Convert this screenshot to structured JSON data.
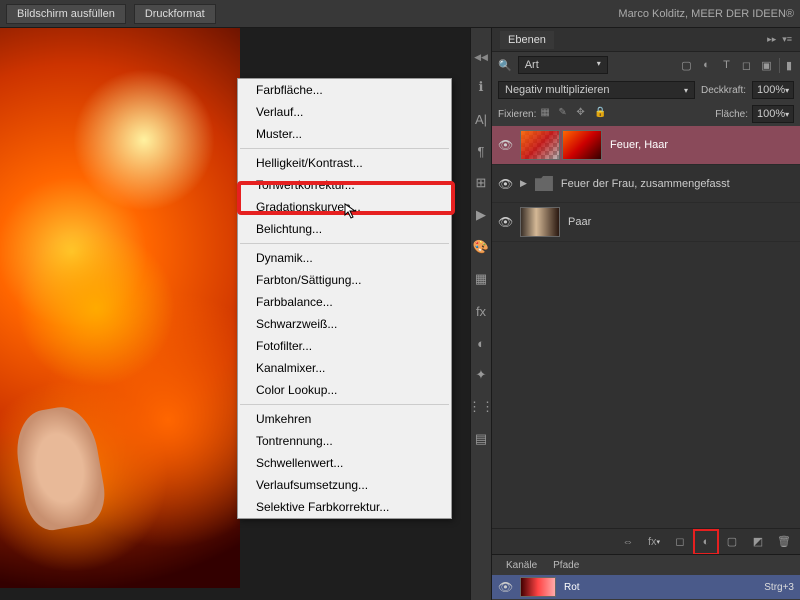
{
  "topbar": {
    "fill_screen": "Bildschirm ausfüllen",
    "print_format": "Druckformat",
    "credit": "Marco Kolditz, MEER DER IDEEN®"
  },
  "context_menu": {
    "groups": [
      [
        "Farbfläche...",
        "Verlauf...",
        "Muster..."
      ],
      [
        "Helligkeit/Kontrast...",
        "Tonwertkorrektur...",
        "Gradationskurven...",
        "Belichtung..."
      ],
      [
        "Dynamik...",
        "Farbton/Sättigung...",
        "Farbbalance...",
        "Schwarzweiß...",
        "Fotofilter...",
        "Kanalmixer...",
        "Color Lookup..."
      ],
      [
        "Umkehren",
        "Tontrennung...",
        "Schwellenwert...",
        "Verlaufsumsetzung...",
        "Selektive Farbkorrektur..."
      ]
    ]
  },
  "layers_panel": {
    "title": "Ebenen",
    "search_value": "Art",
    "blend_mode": "Negativ multiplizieren",
    "opacity_label": "Deckkraft:",
    "opacity_value": "100%",
    "lock_label": "Fixieren:",
    "fill_label": "Fläche:",
    "fill_value": "100%",
    "layers": [
      {
        "name": "Feuer, Haar",
        "selected": true,
        "kind": "fire"
      },
      {
        "name": "Feuer der Frau, zusammengefasst",
        "selected": false,
        "kind": "folder"
      },
      {
        "name": "Paar",
        "selected": false,
        "kind": "couple"
      }
    ]
  },
  "channels_panel": {
    "tabs": [
      "Kanäle",
      "Pfade"
    ],
    "channel_name": "Rot",
    "shortcut": "Strg+3"
  }
}
